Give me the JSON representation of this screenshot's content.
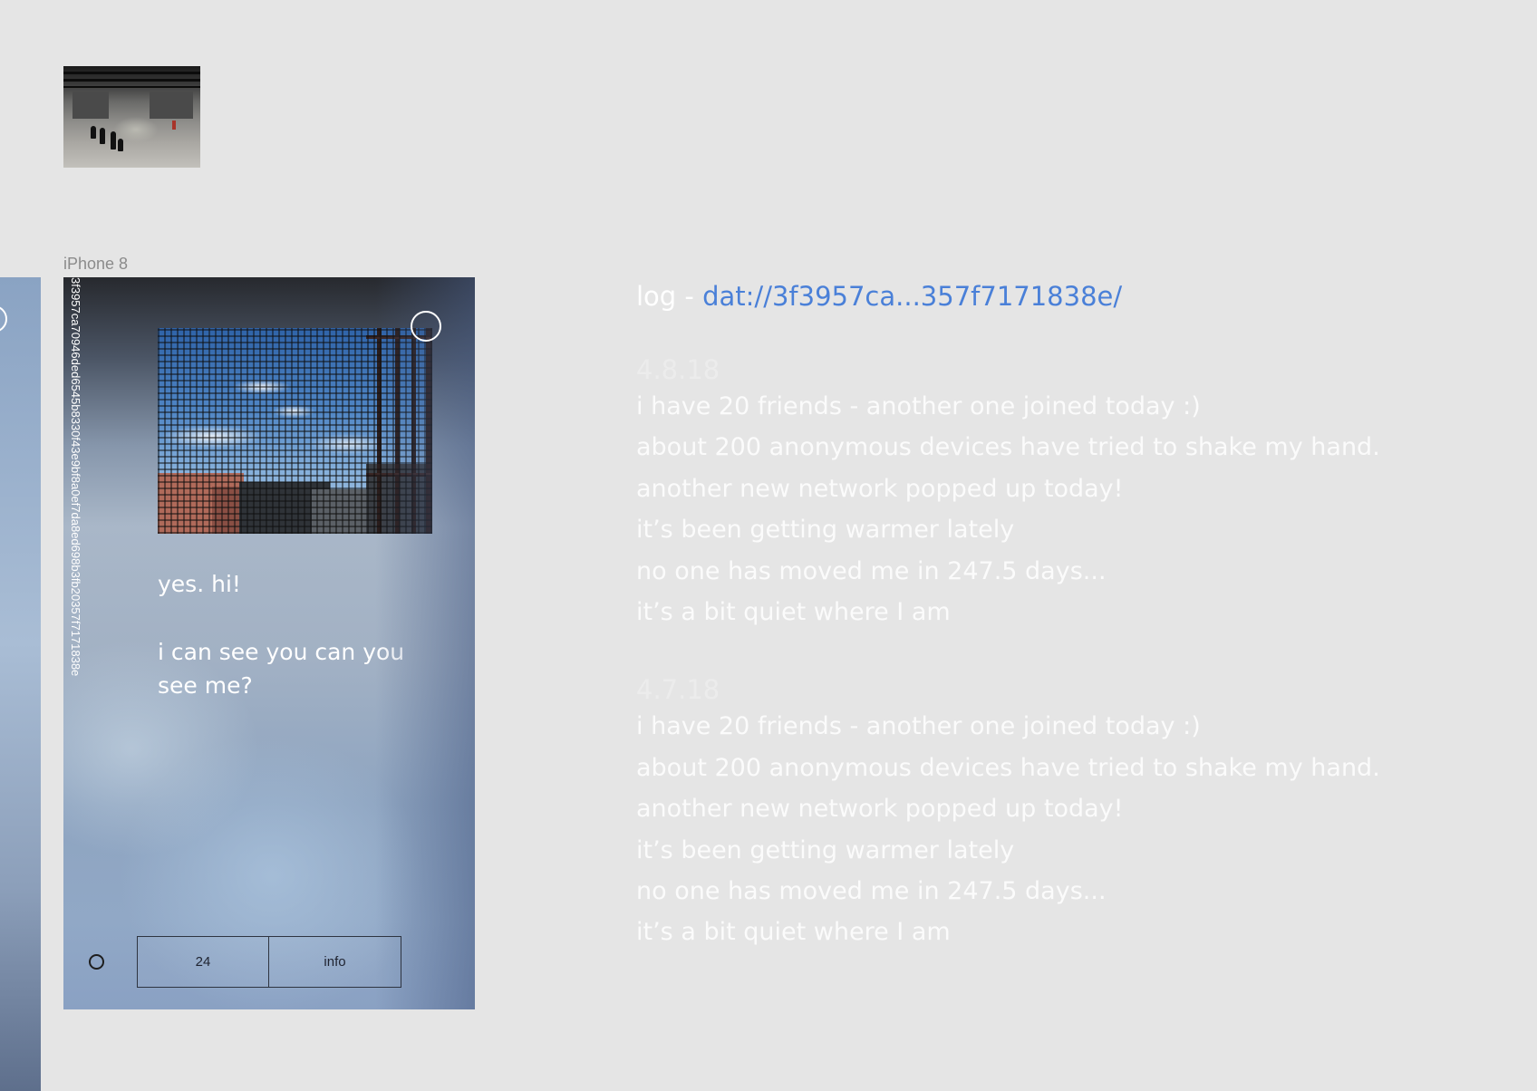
{
  "device": {
    "label": "iPhone 8"
  },
  "app": {
    "hash": "3f3957ca70946ded6545b8330f43e9bf8a0ef7da8ed698b3fb20357f7171838e",
    "messages": [
      "yes. hi!",
      "i can see you can you see me?"
    ],
    "buttons": {
      "count": "24",
      "info": "info"
    }
  },
  "log": {
    "prefix": "log - ",
    "link_text": "dat://3f3957ca...357f7171838e/",
    "entries": [
      {
        "date": "4.8.18",
        "lines": [
          "i have 20 friends - another one joined today :)",
          "about 200 anonymous devices have tried to shake my hand.",
          "another new network popped up today!",
          "it’s been getting warmer lately",
          "no one has moved me in 247.5 days...",
          "it’s a bit quiet where I am"
        ]
      },
      {
        "date": "4.7.18",
        "lines": [
          "i have 20 friends - another one joined today :)",
          "about 200 anonymous devices have tried to shake my hand.",
          "another new network popped up today!",
          "it’s been getting warmer lately",
          "no one has moved me in 247.5 days...",
          "it’s a bit quiet where I am"
        ]
      }
    ]
  },
  "colors": {
    "link": "#4a80d8",
    "canvas": "#e5e5e5",
    "text": "#ffffff"
  }
}
